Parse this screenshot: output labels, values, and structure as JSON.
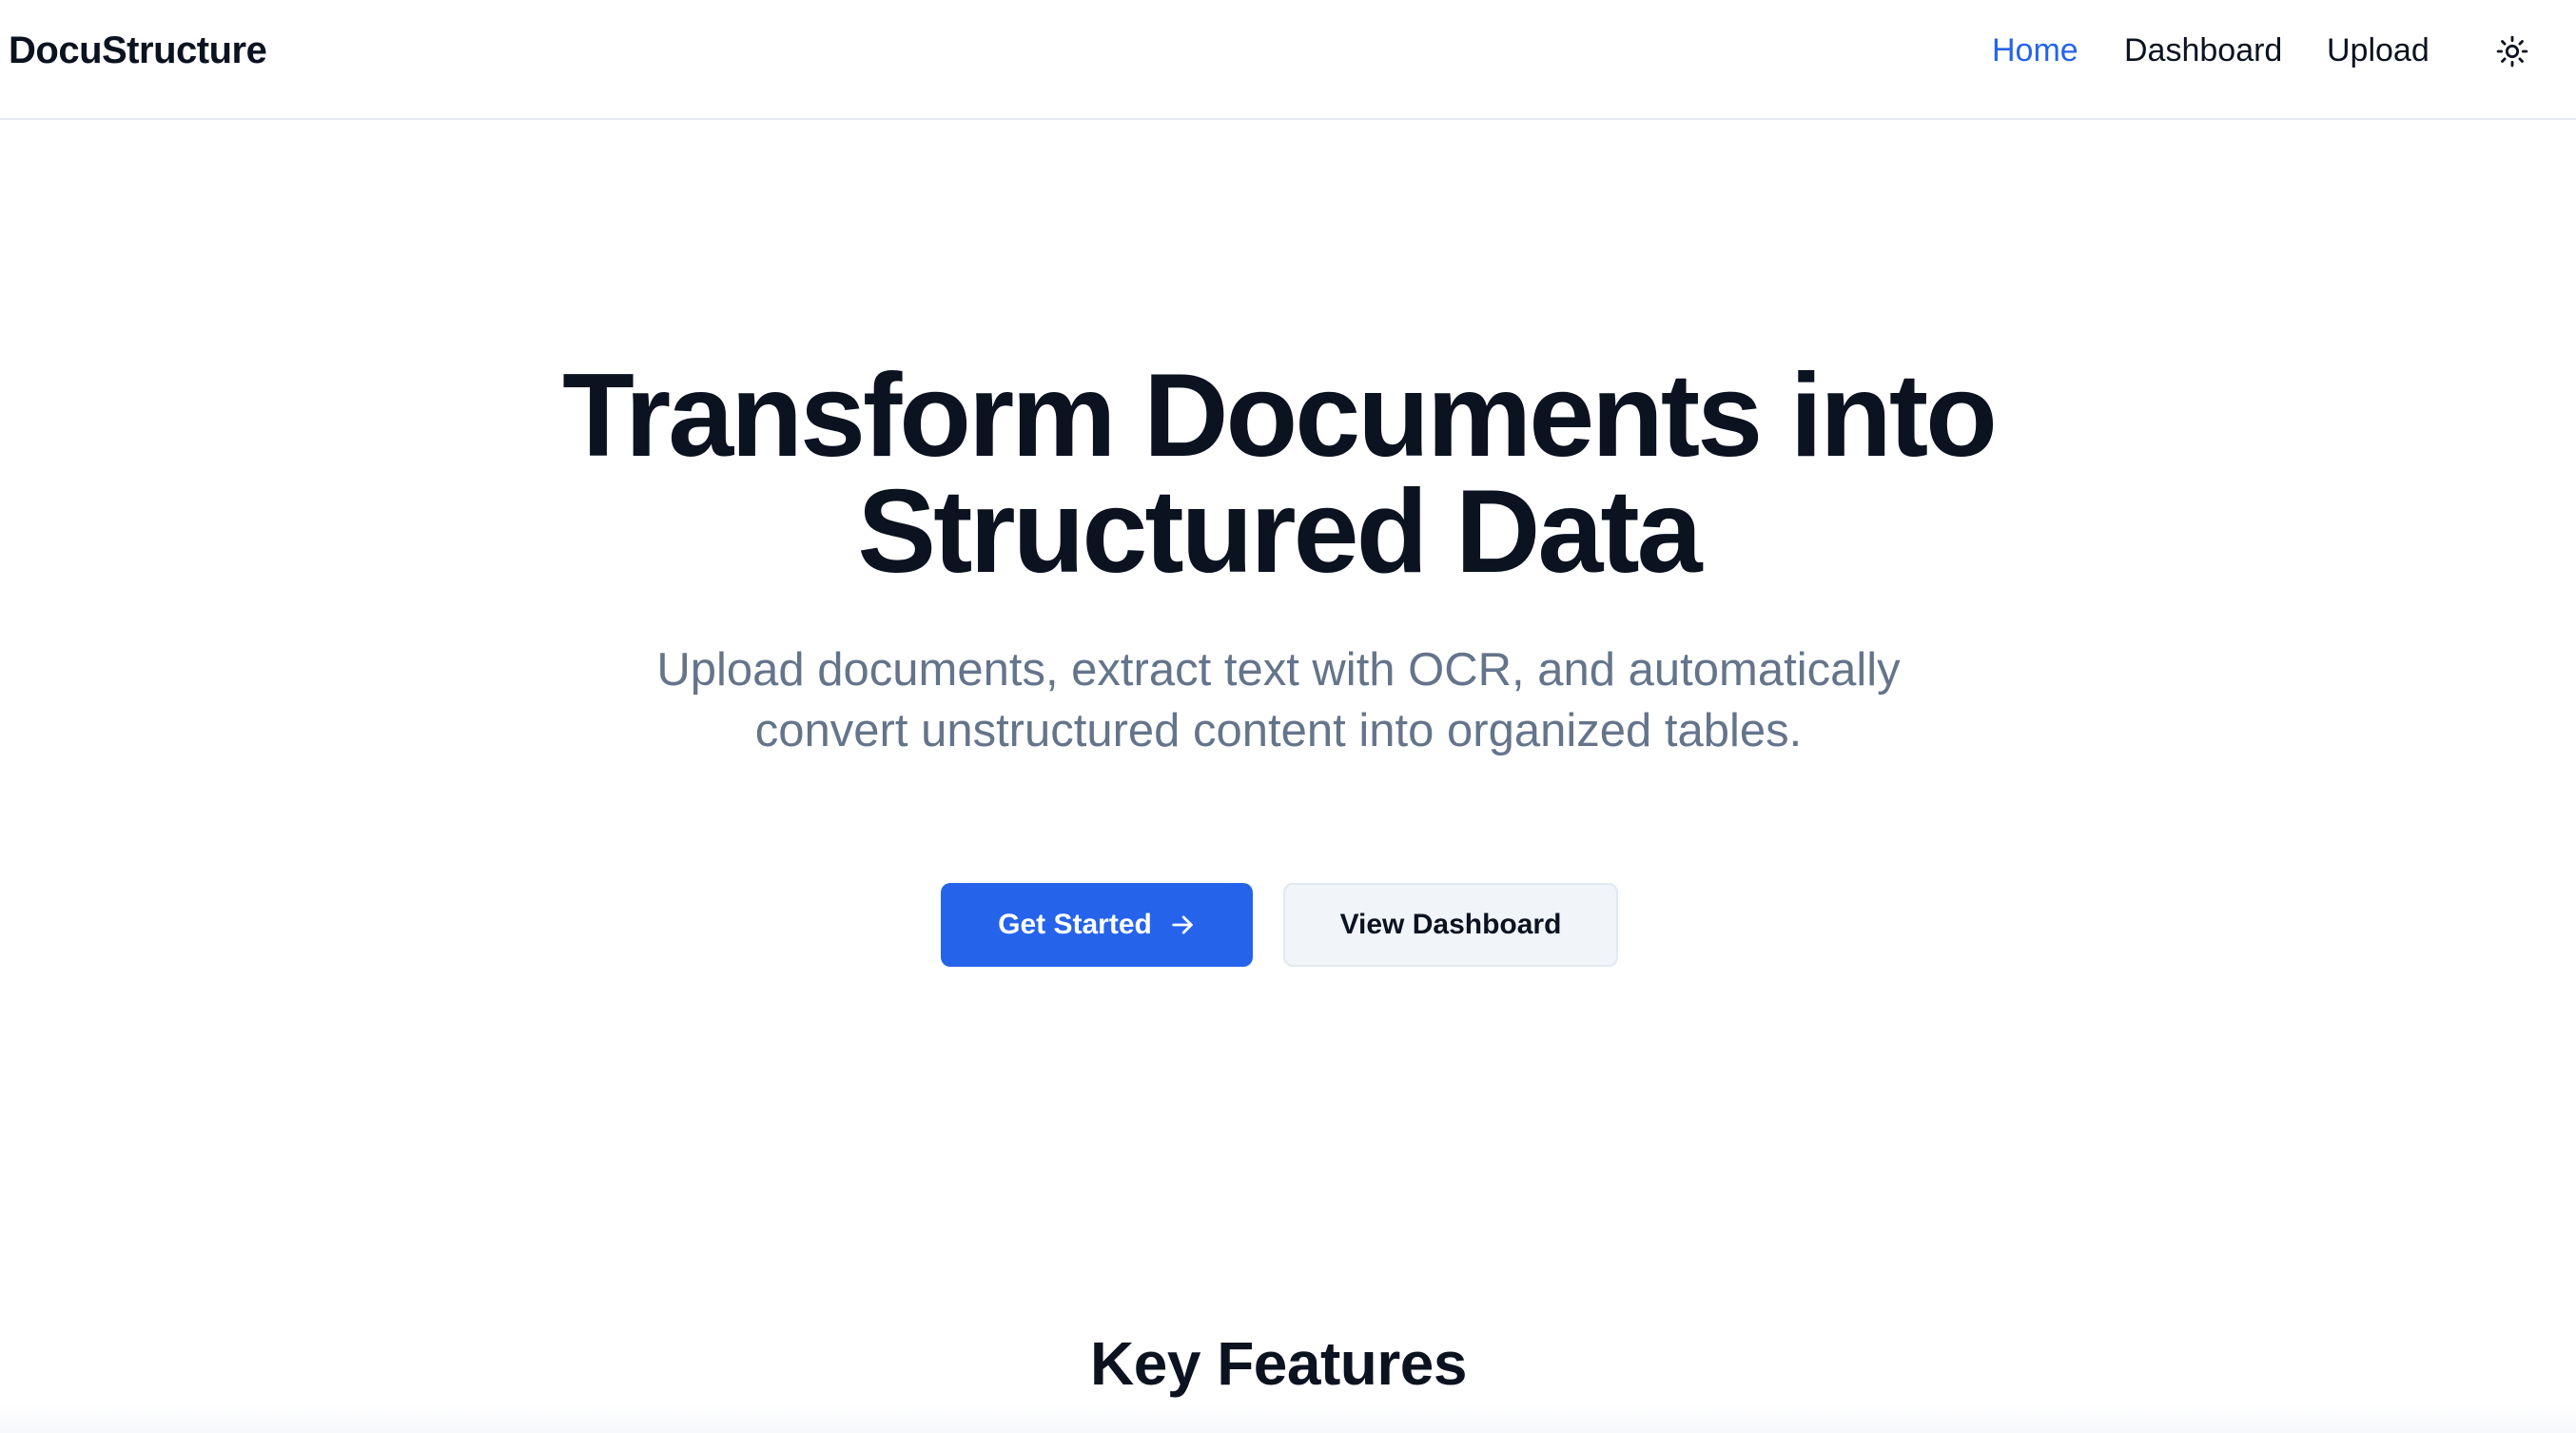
{
  "header": {
    "brand": "DocuStructure",
    "nav": {
      "home": "Home",
      "dashboard": "Dashboard",
      "upload": "Upload"
    },
    "theme_icon": "sun-icon",
    "active_nav": "home",
    "accent_color": "#2563eb"
  },
  "hero": {
    "title_line1": "Transform Documents into",
    "title_line2": "Structured Data",
    "subtitle": "Upload documents, extract text with OCR, and automatically convert unstructured content into organized tables.",
    "primary_button": "Get Started",
    "primary_button_icon": "arrow-right-icon",
    "secondary_button": "View Dashboard"
  },
  "features": {
    "title": "Key Features"
  }
}
